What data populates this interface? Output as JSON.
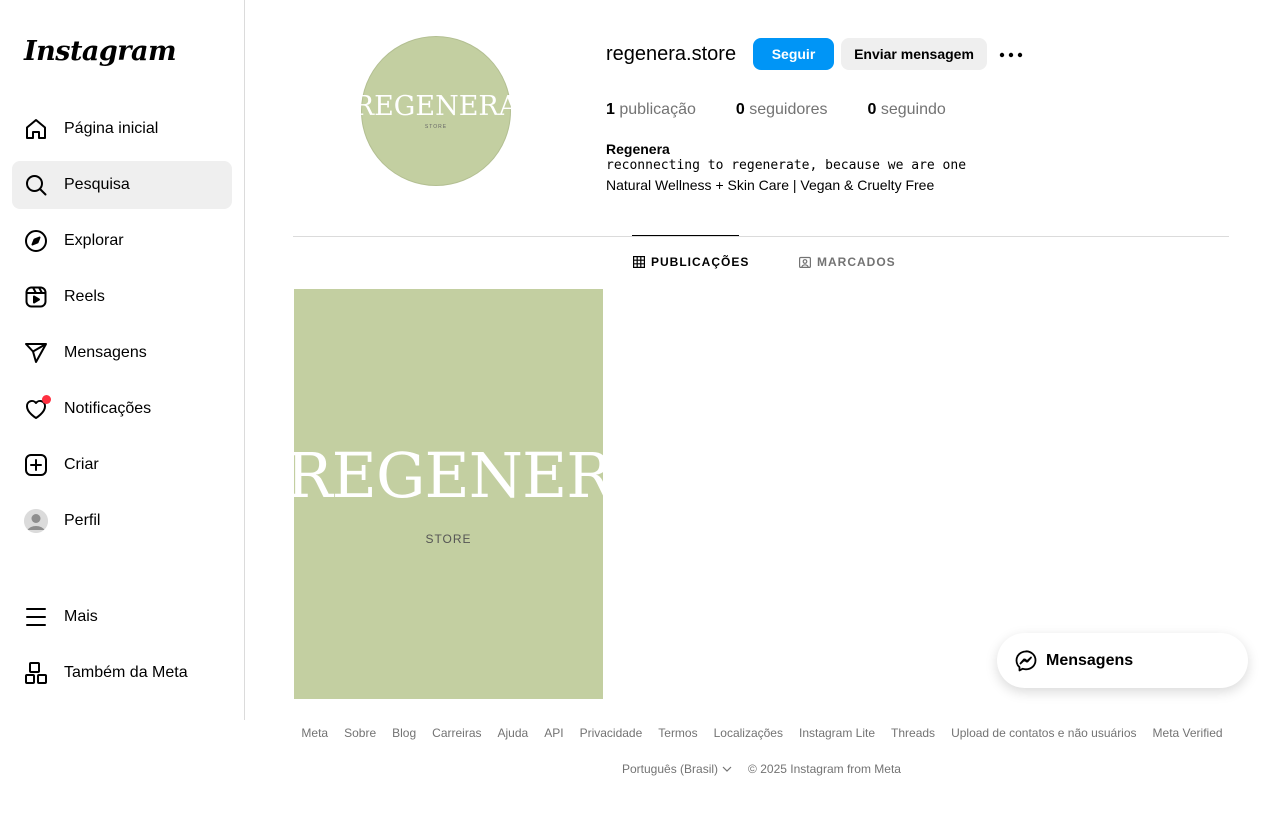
{
  "app": {
    "logo": "Instagram"
  },
  "sidebar": {
    "items": [
      {
        "label": "Página inicial",
        "icon": "home-icon"
      },
      {
        "label": "Pesquisa",
        "icon": "search-icon"
      },
      {
        "label": "Explorar",
        "icon": "compass-icon"
      },
      {
        "label": "Reels",
        "icon": "reels-icon"
      },
      {
        "label": "Mensagens",
        "icon": "send-icon"
      },
      {
        "label": "Notificações",
        "icon": "heart-icon"
      },
      {
        "label": "Criar",
        "icon": "plus-square-icon"
      },
      {
        "label": "Perfil",
        "icon": "avatar"
      },
      {
        "label": "Mais",
        "icon": "menu-icon"
      },
      {
        "label": "Também da Meta",
        "icon": "meta-apps-icon"
      }
    ],
    "active_index": 1
  },
  "profile": {
    "picture_text": "REGENERA",
    "picture_subtext": "STORE",
    "username": "regenera.store",
    "follow_label": "Seguir",
    "message_label": "Enviar mensagem",
    "stats": {
      "posts_count": "1",
      "posts_label": "publicação",
      "followers_count": "0",
      "followers_label": "seguidores",
      "following_count": "0",
      "following_label": "seguindo"
    },
    "bio_name": "Regenera",
    "bio_line1": "reconnecting to regenerate, because we are one",
    "bio_line2": "Natural Wellness + Skin Care | Vegan & Cruelty Free"
  },
  "tabs": {
    "posts": "PUBLICAÇÕES",
    "tagged": "MARCADOS"
  },
  "posts": [
    {
      "title": "REGENERA",
      "subtitle": "STORE"
    }
  ],
  "messages_float": {
    "label": "Mensagens"
  },
  "footer": {
    "links": [
      "Meta",
      "Sobre",
      "Blog",
      "Carreiras",
      "Ajuda",
      "API",
      "Privacidade",
      "Termos",
      "Localizações",
      "Instagram Lite",
      "Threads",
      "Upload de contatos e não usuários",
      "Meta Verified"
    ],
    "language": "Português (Brasil)",
    "copyright": "© 2025 Instagram from Meta"
  },
  "colors": {
    "accent": "#0095f6",
    "brand_green": "#c3cfa1",
    "notification_dot": "#ff3040"
  }
}
